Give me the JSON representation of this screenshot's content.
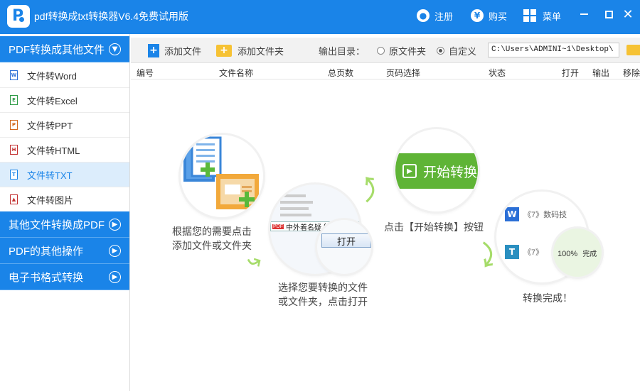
{
  "app": {
    "logo_letter": "P",
    "title": "pdf转换成txt转换器V6.4免费试用版",
    "register_label": "注册",
    "buy_label": "购买",
    "menu_label": "菜单",
    "accent_color": "#1a84e8"
  },
  "sidebar": {
    "categories": [
      {
        "label": "PDF转换成其他文件",
        "expanded": true
      },
      {
        "label": "其他文件转换成PDF"
      },
      {
        "label": "PDF的其他操作"
      },
      {
        "label": "电子书格式转换"
      }
    ],
    "items": [
      {
        "label": "文件转Word",
        "icon": "word-file-icon"
      },
      {
        "label": "文件转Excel",
        "icon": "excel-file-icon"
      },
      {
        "label": "文件转PPT",
        "icon": "ppt-file-icon"
      },
      {
        "label": "文件转HTML",
        "icon": "html-file-icon"
      },
      {
        "label": "文件转TXT",
        "icon": "txt-file-icon",
        "active": true
      },
      {
        "label": "文件转图片",
        "icon": "image-file-icon"
      }
    ]
  },
  "toolbar": {
    "add_file": "添加文件",
    "add_folder": "添加文件夹",
    "output_dir_label": "输出目录：",
    "option_original": "原文件夹",
    "option_custom": "自定义",
    "selected_option": "自定义",
    "path_value": "C:\\Users\\ADMINI~1\\Desktop\\"
  },
  "table": {
    "headers": [
      "编号",
      "文件名称",
      "总页数",
      "页码选择",
      "状态",
      "打开",
      "输出",
      "移除"
    ]
  },
  "guide": {
    "step1": "根据您的需要点击\n添加文件或文件夹",
    "step2": "选择您要转换的文件\n或文件夹，点击打开",
    "step3": "点击【开始转换】按钮",
    "step4": "转换完成！",
    "dialog_filename": "中外着名疑",
    "dialog_filter": "(*.pdf,*.",
    "dialog_pdf_tag": "PDF",
    "open_button": "打开",
    "start_button": "开始转换",
    "done_item1": "《7》数码技",
    "done_item2": "《7》",
    "done_percent": "100%",
    "done_status": "完成",
    "done_w_letter": "W",
    "done_t_letter": "T"
  }
}
